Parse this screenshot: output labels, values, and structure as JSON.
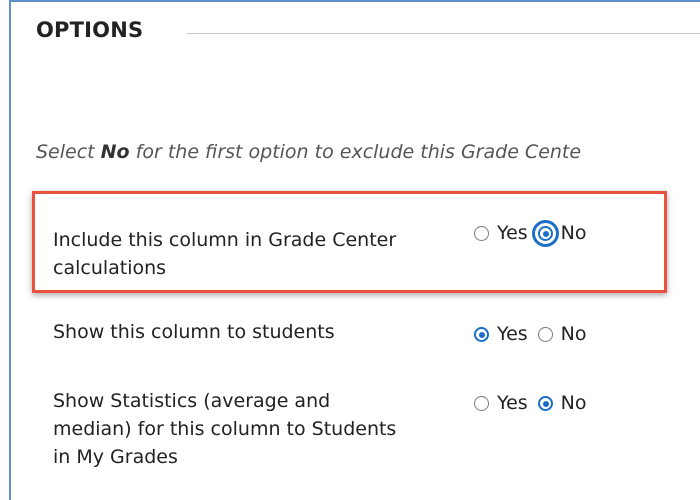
{
  "section": {
    "title": "OPTIONS"
  },
  "instruction": {
    "prefix": "Select ",
    "emphasis": "No",
    "suffix": " for the first option to exclude this Grade Cente"
  },
  "options": [
    {
      "label": "Include this column in Grade Center calculations",
      "yes_label": "Yes",
      "no_label": "No",
      "selected": "No",
      "focused": "No"
    },
    {
      "label": "Show this column to students",
      "yes_label": "Yes",
      "no_label": "No",
      "selected": "Yes"
    },
    {
      "label": "Show Statistics (average and median) for this column to Students in My Grades",
      "yes_label": "Yes",
      "no_label": "No",
      "selected": "No"
    }
  ],
  "colors": {
    "accent": "#1b6fc8",
    "highlight_border": "#e8533f",
    "frame_border": "#5f8fc5"
  }
}
